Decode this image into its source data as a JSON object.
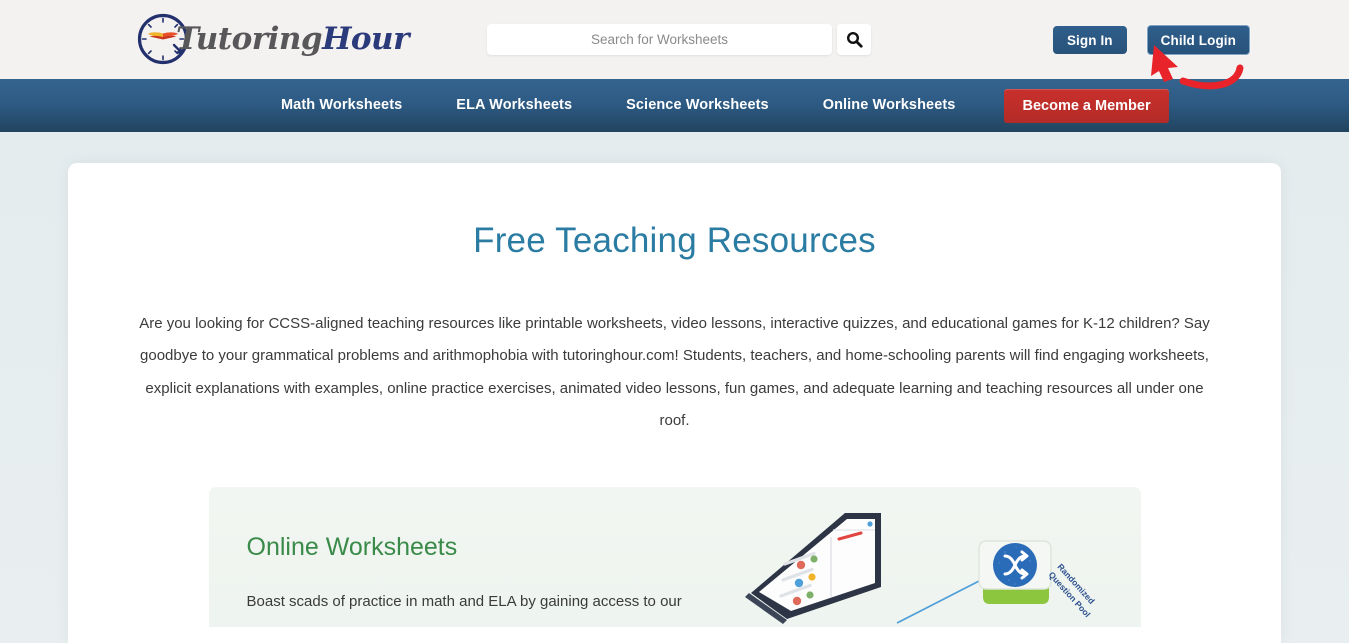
{
  "site": {
    "logo": {
      "icon": "clock-book-icon",
      "text_primary": "Tutoring",
      "text_secondary": "Hour"
    }
  },
  "header": {
    "search": {
      "icon": "search-icon",
      "placeholder": "Search for Worksheets",
      "value": ""
    },
    "auth": {
      "sign_in_label": "Sign In",
      "child_login_label": "Child Login"
    },
    "annotation": {
      "type": "curved-arrow",
      "color": "#e8232a",
      "points_to": "Child Login"
    },
    "colors": {
      "background": "#f4f2f0",
      "button": "#2b5880"
    }
  },
  "navbar": {
    "items": [
      {
        "label": "Math Worksheets"
      },
      {
        "label": "ELA Worksheets"
      },
      {
        "label": "Science Worksheets"
      },
      {
        "label": "Online Worksheets"
      }
    ],
    "cta": {
      "label": "Become a Member",
      "color": "#c12f2b"
    },
    "colors": {
      "top": "#34648f",
      "bottom": "#21445f"
    }
  },
  "main": {
    "title": "Free Teaching Resources",
    "title_color": "#2a7ca3",
    "intro": "Are you looking for CCSS-aligned teaching resources like printable worksheets, video lessons, interactive quizzes, and educational games for K-12 children? Say goodbye to your grammatical problems and arithmophobia with tutoringhour.com! Students, teachers, and home-schooling parents will find engaging worksheets, explicit explanations with examples, online practice exercises, animated video lessons, fun games, and adequate learning and teaching resources all under one roof.",
    "online_worksheets": {
      "heading": "Online Worksheets",
      "heading_color": "#3a8a49",
      "body": "Boast scads of practice in math and ELA by gaining access to our",
      "illustration": {
        "name": "isometric-laptop-randomized-pool",
        "badge_label": "Randomized Question Pool",
        "badge_icon": "shuffle-icon",
        "badge_color": "#2b6cb8",
        "base_color": "#8cc63f"
      }
    }
  },
  "page": {
    "background": "#e7eef0"
  }
}
